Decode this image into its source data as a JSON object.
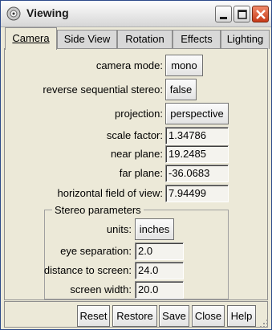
{
  "window": {
    "title": "Viewing",
    "colors": {
      "close_button": "#c73a17",
      "frame": "#ece9d8",
      "title_bar": "#ececec"
    }
  },
  "tabs": [
    {
      "label": "Camera",
      "active": true
    },
    {
      "label": "Side View",
      "active": false
    },
    {
      "label": "Rotation",
      "active": false
    },
    {
      "label": "Effects",
      "active": false
    },
    {
      "label": "Lighting",
      "active": false
    }
  ],
  "camera": {
    "camera_mode": {
      "label": "camera mode:",
      "value": "mono"
    },
    "reverse_stereo": {
      "label": "reverse sequential stereo:",
      "value": "false"
    },
    "projection": {
      "label": "projection:",
      "value": "perspective"
    },
    "scale_factor": {
      "label": "scale factor:",
      "value": "1.34786"
    },
    "near_plane": {
      "label": "near plane:",
      "value": "19.2485"
    },
    "far_plane": {
      "label": "far plane:",
      "value": "-36.0683"
    },
    "fov": {
      "label": "horizontal field of view:",
      "value": "7.94499"
    }
  },
  "stereo": {
    "title": "Stereo parameters",
    "units": {
      "label": "units:",
      "value": "inches"
    },
    "eye_separation": {
      "label": "eye separation:",
      "value": "2.0"
    },
    "distance": {
      "label": "distance to screen:",
      "value": "24.0"
    },
    "screen_width": {
      "label": "screen width:",
      "value": "20.0"
    }
  },
  "buttons": {
    "reset": "Reset",
    "restore": "Restore",
    "save": "Save",
    "close": "Close",
    "help": "Help"
  }
}
